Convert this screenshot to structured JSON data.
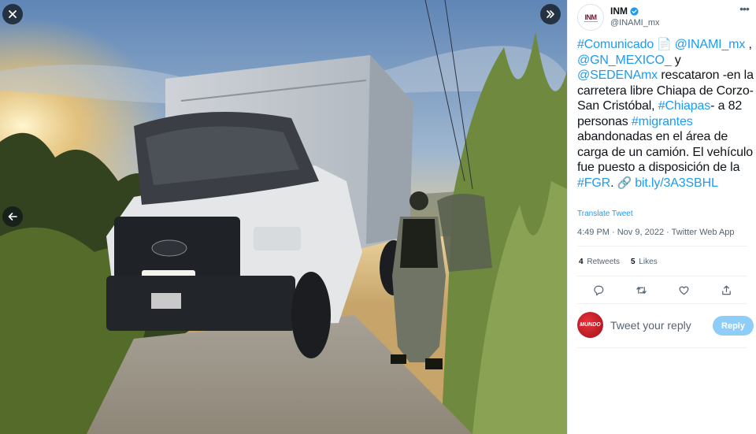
{
  "viewer": {
    "close_icon": "close-icon",
    "next_icon": "double-chevron-right-icon",
    "prev_icon": "arrow-left-icon"
  },
  "author": {
    "name": "INM",
    "handle": "@INAMI_mx",
    "avatar_text": "INM",
    "verified": true
  },
  "tweet": {
    "parts": [
      {
        "t": "#Comunicado",
        "link": true
      },
      {
        "t": " 📄 ",
        "emoji": true
      },
      {
        "t": "@INAMI_mx",
        "link": true
      },
      {
        "t": " , ",
        "link": false
      },
      {
        "t": "@GN_MEXICO_",
        "link": true
      },
      {
        "t": " y ",
        "link": false
      },
      {
        "t": "@SEDENAmx",
        "link": true
      },
      {
        "t": " rescataron -en la carretera libre Chiapa de Corzo-San Cristóbal, ",
        "link": false
      },
      {
        "t": "#Chiapas",
        "link": true
      },
      {
        "t": "- a 82 personas ",
        "link": false
      },
      {
        "t": "#migrantes",
        "link": true
      },
      {
        "t": " abandonadas en el área de carga de un camión. El vehículo fue puesto a disposición de la ",
        "link": false
      },
      {
        "t": "#FGR",
        "link": true
      },
      {
        "t": ". ",
        "link": false
      },
      {
        "t": "🔗 ",
        "emoji": true
      },
      {
        "t": "bit.ly/3A3SBHL",
        "link": true
      }
    ],
    "translate_label": "Translate Tweet",
    "timestamp": "4:49 PM · Nov 9, 2022 · Twitter Web App"
  },
  "stats": {
    "retweets_count": "4",
    "retweets_label": "Retweets",
    "likes_count": "5",
    "likes_label": "Likes"
  },
  "reply": {
    "avatar_text": "MUNDO",
    "placeholder": "Tweet your reply",
    "button_label": "Reply"
  },
  "colors": {
    "link": "#1d9bf0",
    "reply_button": "#8ecdf8",
    "text": "#0f1419",
    "muted": "#536471"
  }
}
